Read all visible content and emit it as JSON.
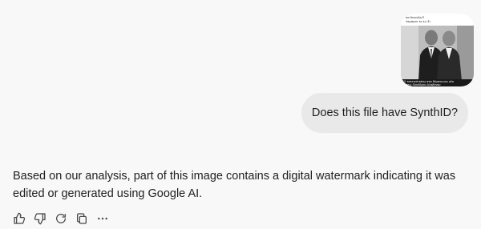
{
  "attachment": {
    "caption_top_line1": "ασ δεκινδρ Ε",
    "caption_top_line2": "λαμαμαι το κι ιΣι",
    "caption_bottom_line1": "15 τακτικά πάνω στα θέματα και νέα",
    "caption_bottom_line2": "φάσεις Προέδρου Αλαβάνου"
  },
  "user_message": {
    "text": "Does this file have SynthID?"
  },
  "assistant_message": {
    "text": "Based on our analysis, part of this image contains a digital watermark indicating it was edited or generated using Google AI."
  },
  "actions": {
    "items": [
      "thumbs-up-icon",
      "thumbs-down-icon",
      "regenerate-icon",
      "copy-icon",
      "more-icon"
    ]
  },
  "colors": {
    "background": "#f8f8f8",
    "user_bubble": "#e9e9e9",
    "text": "#1f1f1f",
    "icon": "#444746"
  }
}
